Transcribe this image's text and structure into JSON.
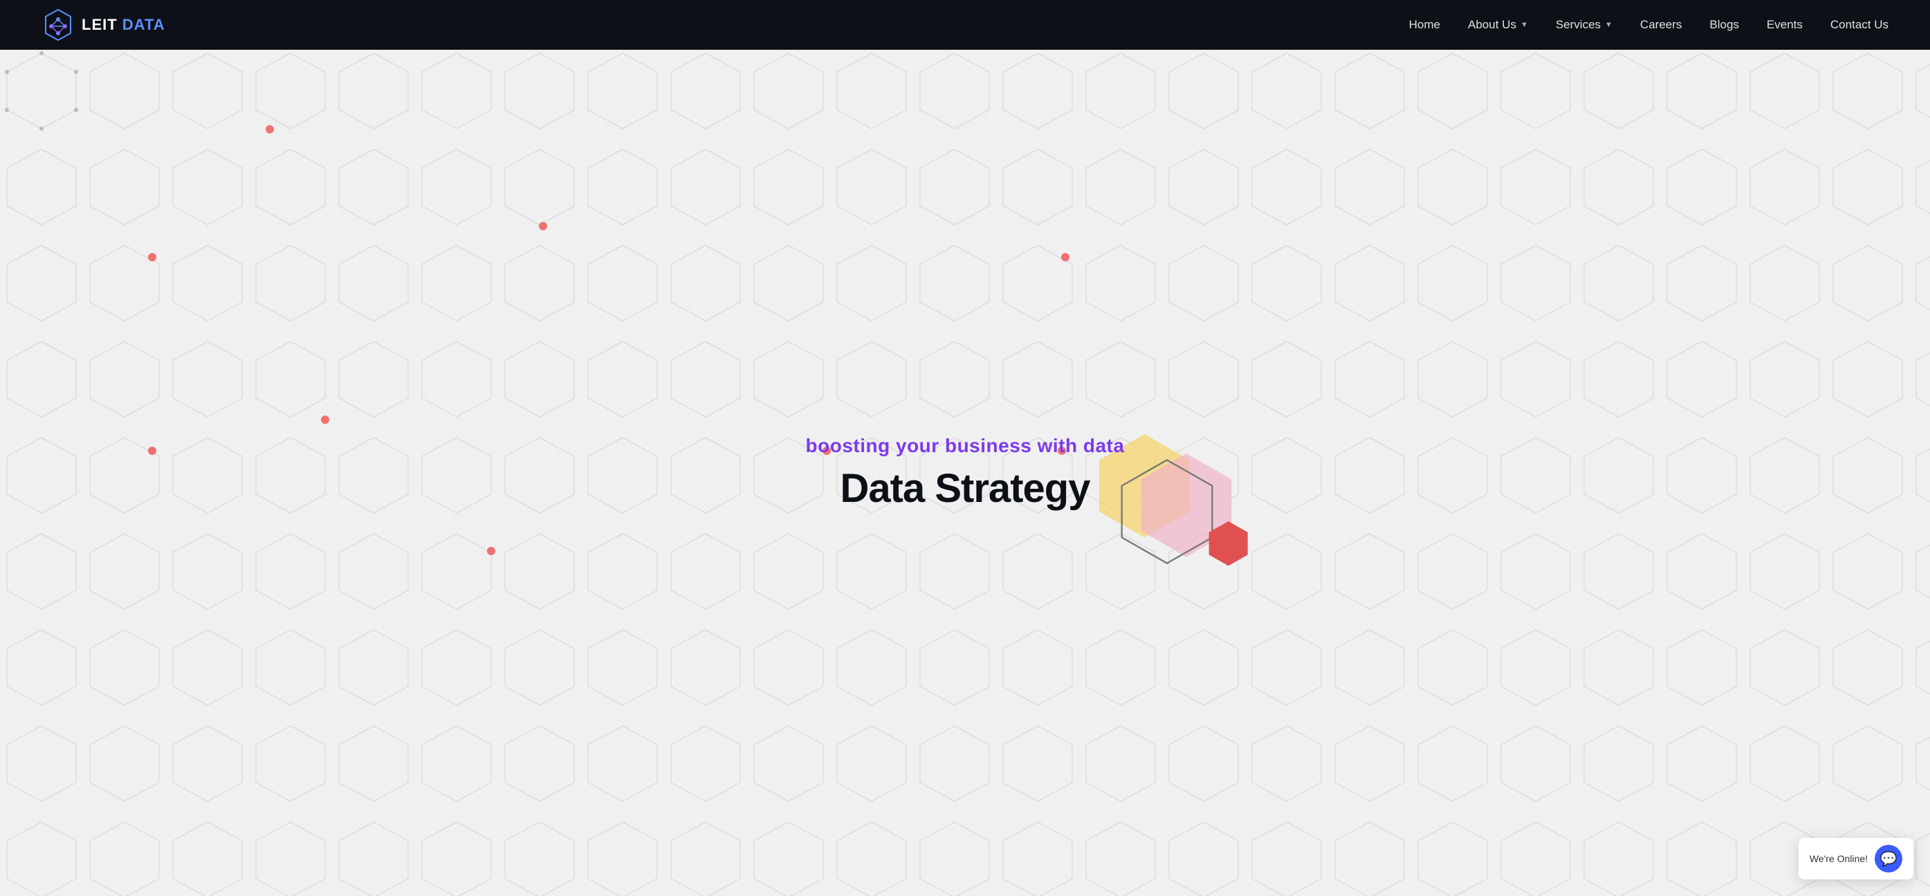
{
  "nav": {
    "logo_text_1": "LEIT",
    "logo_text_2": "DATA",
    "links": [
      {
        "label": "Home",
        "has_dropdown": false
      },
      {
        "label": "About Us",
        "has_dropdown": true
      },
      {
        "label": "Services",
        "has_dropdown": true
      },
      {
        "label": "Careers",
        "has_dropdown": false
      },
      {
        "label": "Blogs",
        "has_dropdown": false
      },
      {
        "label": "Events",
        "has_dropdown": false
      },
      {
        "label": "Contact Us",
        "has_dropdown": false
      }
    ]
  },
  "hero": {
    "subtitle": "boosting your business with data",
    "title": "Data Strategy"
  },
  "chat": {
    "label": "We're Online!"
  },
  "colors": {
    "nav_bg": "#0d1117",
    "accent_purple": "#7c3aed",
    "accent_blue": "#3b5bfc",
    "hero_bg": "#f0f0f0",
    "hex_yellow": "#f5d97a",
    "hex_pink": "#f0b8c8",
    "hex_red": "#e05050",
    "hex_outline": "#888"
  }
}
